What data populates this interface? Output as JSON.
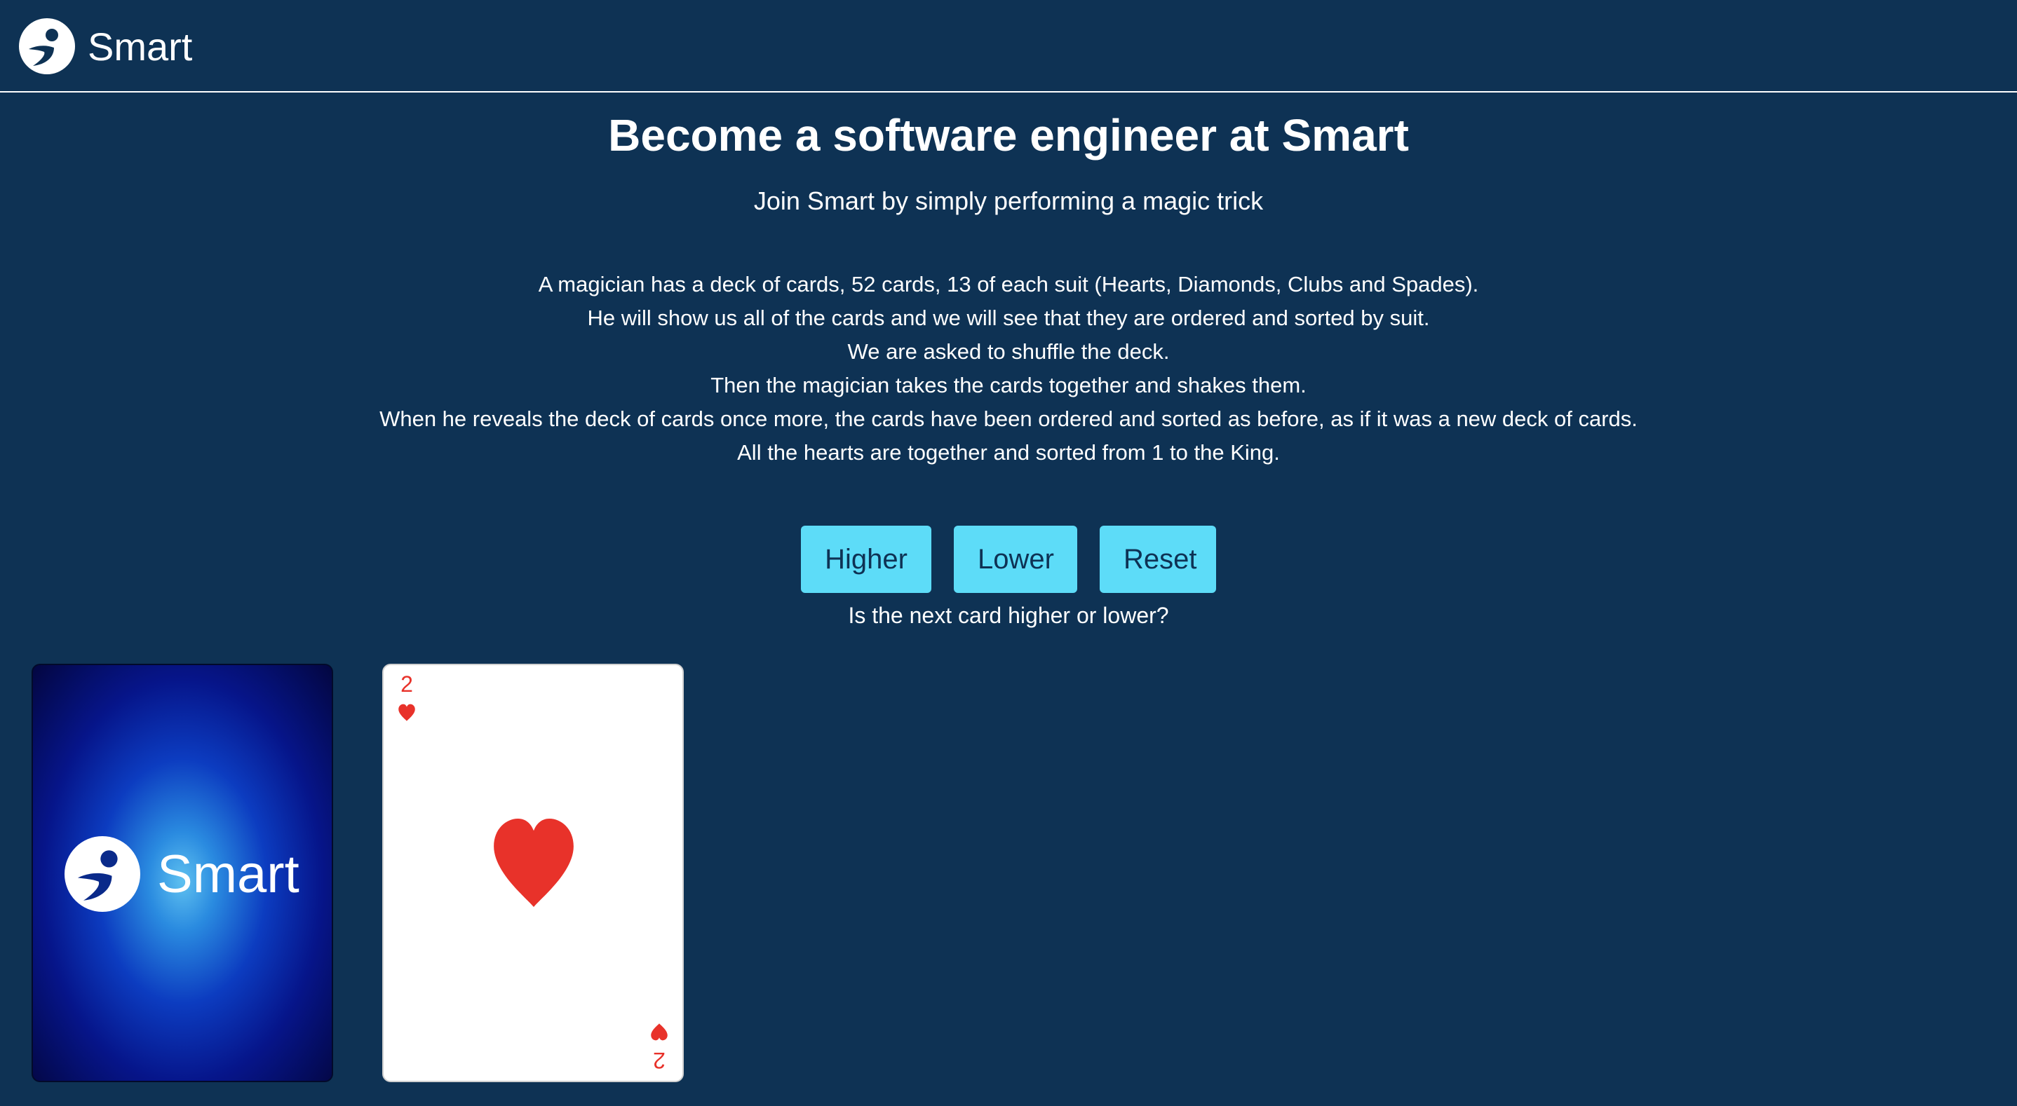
{
  "header": {
    "brand": "Smart"
  },
  "hero": {
    "title": "Become a software engineer at Smart",
    "subtitle": "Join Smart by simply performing a magic trick"
  },
  "description": {
    "lines": [
      "A magician has a deck of cards, 52 cards, 13 of each suit (Hearts, Diamonds, Clubs and Spades).",
      "He will show us all of the cards and we will see that they are ordered and sorted by suit.",
      "We are asked to shuffle the deck.",
      "Then the magician takes the cards together and shakes them.",
      "When he reveals the deck of cards once more, the cards have been ordered and sorted as before, as if it was a new deck of cards.",
      "All the hearts are together and sorted from 1 to the King."
    ]
  },
  "controls": {
    "higher_label": "Higher",
    "lower_label": "Lower",
    "reset_label": "Reset",
    "prompt": "Is the next card higher or lower?"
  },
  "deck": {
    "back_brand": "Smart"
  },
  "current_card": {
    "rank": "2",
    "suit": "hearts",
    "suit_color": "#e8322a"
  },
  "colors": {
    "background": "#0e3254",
    "button": "#5ddcf8",
    "button_text": "#0e3254"
  },
  "icons": {
    "logo": "smart-logo-icon",
    "suit": "heart-icon"
  }
}
